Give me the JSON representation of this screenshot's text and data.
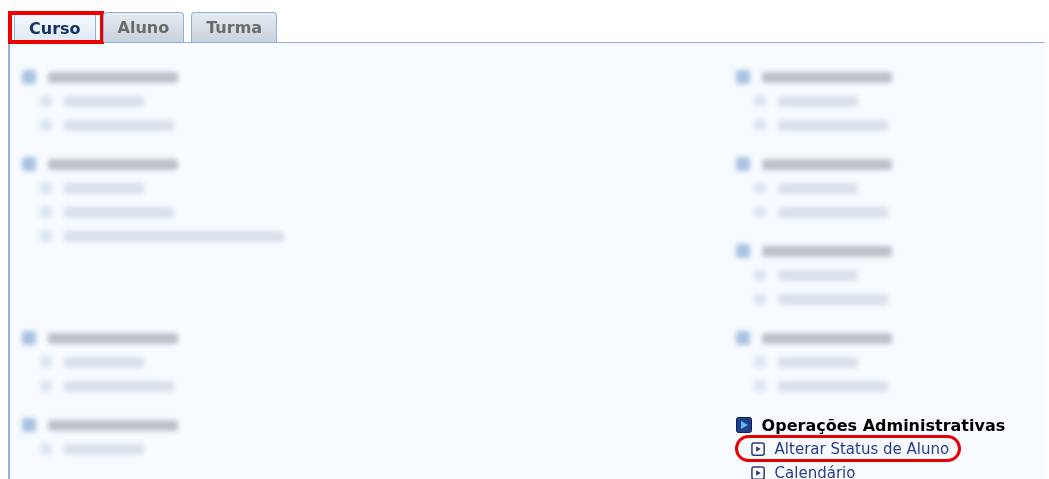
{
  "tabs": [
    {
      "label": "Curso",
      "selected": true,
      "highlighted": true
    },
    {
      "label": "Aluno",
      "selected": false,
      "highlighted": false
    },
    {
      "label": "Turma",
      "selected": false,
      "highlighted": false
    }
  ],
  "columns": [
    {
      "sections": [
        {
          "kind": "blurred",
          "items": [
            {
              "kind": "blurred"
            },
            {
              "kind": "blurred"
            }
          ]
        },
        {
          "kind": "blurred",
          "items": [
            {
              "kind": "blurred"
            },
            {
              "kind": "blurred"
            },
            {
              "kind": "blurred"
            }
          ]
        },
        {
          "kind": "blurred",
          "items": [
            {
              "kind": "blurred"
            },
            {
              "kind": "blurred"
            }
          ]
        },
        {
          "kind": "blurred",
          "items": [
            {
              "kind": "blurred"
            }
          ]
        }
      ]
    },
    {
      "sections": [
        {
          "kind": "blurred",
          "items": [
            {
              "kind": "blurred"
            },
            {
              "kind": "blurred"
            }
          ]
        },
        {
          "kind": "blurred",
          "items": [
            {
              "kind": "blurred"
            },
            {
              "kind": "blurred"
            }
          ]
        },
        {
          "kind": "blurred",
          "items": [
            {
              "kind": "blurred"
            },
            {
              "kind": "blurred"
            }
          ]
        },
        {
          "kind": "blurred",
          "items": [
            {
              "kind": "blurred"
            },
            {
              "kind": "blurred"
            }
          ]
        },
        {
          "kind": "menu",
          "title": "Operações Administrativas",
          "items": [
            {
              "kind": "link",
              "label": "Alterar Status de Aluno",
              "highlighted": true
            },
            {
              "kind": "link",
              "label": "Calendário",
              "highlighted": false
            }
          ]
        }
      ]
    }
  ]
}
